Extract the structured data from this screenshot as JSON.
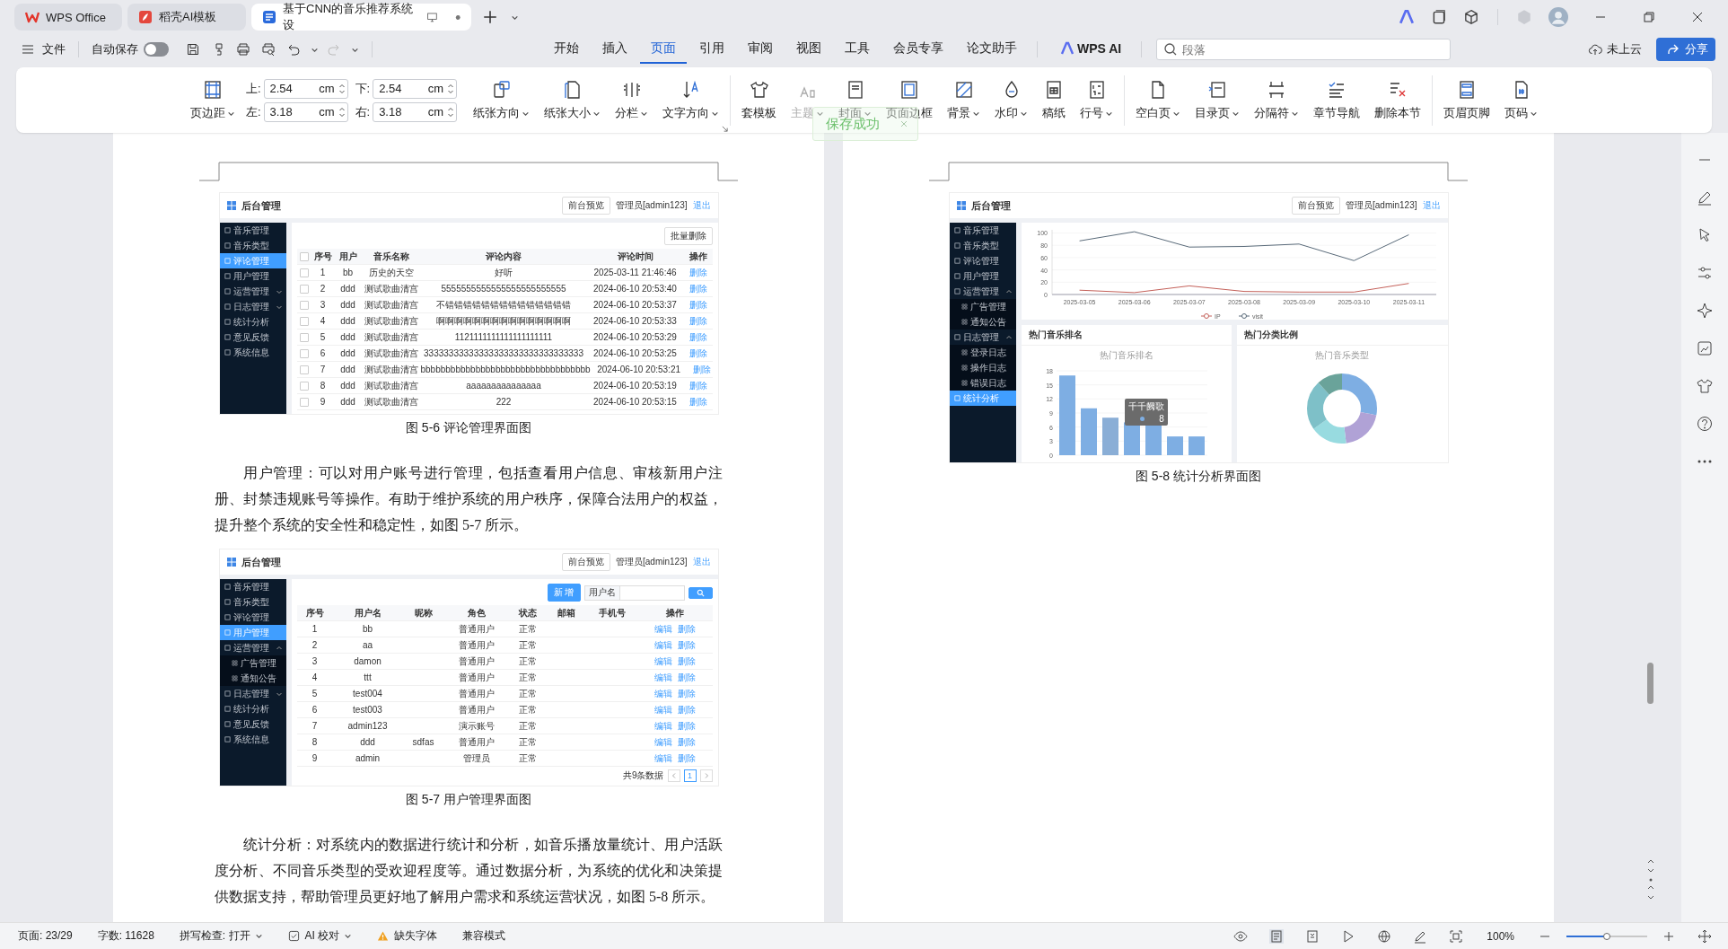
{
  "title_tabs": [
    {
      "label": "WPS Office",
      "kind": "home",
      "selected": false
    },
    {
      "label": "稻壳AI模板",
      "kind": "template",
      "selected": false
    },
    {
      "label": "基于CNN的音乐推荐系统设",
      "kind": "document",
      "selected": true
    }
  ],
  "menu": {
    "file": "文件",
    "autosave": {
      "label": "自动保存",
      "on": false
    },
    "tabs": [
      {
        "label": "开始",
        "selected": false
      },
      {
        "label": "插入",
        "selected": false
      },
      {
        "label": "页面",
        "selected": true
      },
      {
        "label": "引用",
        "selected": false
      },
      {
        "label": "审阅",
        "selected": false
      },
      {
        "label": "视图",
        "selected": false
      },
      {
        "label": "工具",
        "selected": false
      },
      {
        "label": "会员专享",
        "selected": false
      },
      {
        "label": "论文助手",
        "selected": false
      }
    ],
    "ai": "WPS AI",
    "search": {
      "placeholder": "段落"
    },
    "cloud": "未上云",
    "share": "分享"
  },
  "ribbon": {
    "margin_button": "页边距",
    "margins": [
      {
        "label": "上:",
        "value": "2.54",
        "unit": "cm"
      },
      {
        "label": "下:",
        "value": "2.54",
        "unit": "cm"
      },
      {
        "label": "左:",
        "value": "3.18",
        "unit": "cm"
      },
      {
        "label": "右:",
        "value": "3.18",
        "unit": "cm"
      }
    ],
    "groups": [
      [
        {
          "label": "纸张方向",
          "dropdown": true,
          "disabled": false
        },
        {
          "label": "纸张大小",
          "dropdown": true,
          "disabled": false
        },
        {
          "label": "分栏",
          "dropdown": true,
          "disabled": false
        },
        {
          "label": "文字方向",
          "dropdown": true,
          "disabled": false
        }
      ],
      [
        {
          "label": "套模板",
          "dropdown": false,
          "disabled": false
        },
        {
          "label": "主题",
          "dropdown": true,
          "disabled": true
        },
        {
          "label": "封面",
          "dropdown": true,
          "disabled": false
        },
        {
          "label": "页面边框",
          "dropdown": false,
          "disabled": false
        },
        {
          "label": "背景",
          "dropdown": true,
          "disabled": false
        },
        {
          "label": "水印",
          "dropdown": true,
          "disabled": false
        },
        {
          "label": "稿纸",
          "dropdown": false,
          "disabled": false
        },
        {
          "label": "行号",
          "dropdown": true,
          "disabled": false
        }
      ],
      [
        {
          "label": "空白页",
          "dropdown": true,
          "disabled": false
        },
        {
          "label": "目录页",
          "dropdown": true,
          "disabled": false
        },
        {
          "label": "分隔符",
          "dropdown": true,
          "disabled": false
        },
        {
          "label": "章节导航",
          "dropdown": false,
          "disabled": false
        },
        {
          "label": "删除本节",
          "dropdown": false,
          "disabled": false
        }
      ],
      [
        {
          "label": "页眉页脚",
          "dropdown": false,
          "disabled": false
        },
        {
          "label": "页码",
          "dropdown": true,
          "disabled": false
        }
      ]
    ]
  },
  "toast": {
    "text": "保存成功"
  },
  "pages": [
    {
      "blocks": [
        {
          "kind": "figure",
          "figure": {
            "kind": "comments",
            "header_checked": false,
            "header": {
              "title": "后台管理",
              "preview": "前台预览",
              "user": "管理员[admin123]",
              "logout": "退出"
            },
            "sidebar": [
              {
                "label": "音乐管理",
                "selected": false
              },
              {
                "label": "音乐类型",
                "selected": false
              },
              {
                "label": "评论管理",
                "selected": true
              },
              {
                "label": "用户管理",
                "selected": false
              },
              {
                "label": "运营管理",
                "selected": false,
                "expanded": false
              },
              {
                "label": "日志管理",
                "selected": false,
                "expanded": false
              },
              {
                "label": "统计分析",
                "selected": false
              },
              {
                "label": "意见反馈",
                "selected": false
              },
              {
                "label": "系统信息",
                "selected": false
              }
            ],
            "bulk_delete": "批量删除",
            "columns": [
              "序号",
              "用户",
              "音乐名称",
              "评论内容",
              "评论时间",
              "操作"
            ],
            "rows": [
              {
                "checked": false,
                "cells": [
                  "1",
                  "bb",
                  "历史的天空",
                  "好听",
                  "2025-03-11 21:46:46"
                ],
                "action": "删除"
              },
              {
                "checked": false,
                "cells": [
                  "2",
                  "ddd",
                  "测试歌曲清宫",
                  "5555555555555555555555555",
                  "2024-06-10 20:53:40"
                ],
                "action": "删除"
              },
              {
                "checked": false,
                "cells": [
                  "3",
                  "ddd",
                  "测试歌曲清宫",
                  "不错错错错错错错错错错错错错错",
                  "2024-06-10 20:53:37"
                ],
                "action": "删除"
              },
              {
                "checked": false,
                "cells": [
                  "4",
                  "ddd",
                  "测试歌曲清宫",
                  "啊啊啊啊啊啊啊啊啊啊啊啊啊啊啊",
                  "2024-06-10 20:53:33"
                ],
                "action": "删除"
              },
              {
                "checked": false,
                "cells": [
                  "5",
                  "ddd",
                  "测试歌曲清宫",
                  "1121111111111111111111",
                  "2024-06-10 20:53:29"
                ],
                "action": "删除"
              },
              {
                "checked": false,
                "cells": [
                  "6",
                  "ddd",
                  "测试歌曲清宫",
                  "33333333333333333333333333333333",
                  "2024-06-10 20:53:25"
                ],
                "action": "删除"
              },
              {
                "checked": false,
                "cells": [
                  "7",
                  "ddd",
                  "测试歌曲清宫",
                  "bbbbbbbbbbbbbbbbbbbbbbbbbbbbbbbbbb",
                  "2024-06-10 20:53:21"
                ],
                "action": "删除"
              },
              {
                "checked": false,
                "cells": [
                  "8",
                  "ddd",
                  "测试歌曲清宫",
                  "aaaaaaaaaaaaaaa",
                  "2024-06-10 20:53:19"
                ],
                "action": "删除"
              },
              {
                "checked": false,
                "cells": [
                  "9",
                  "ddd",
                  "测试歌曲清宫",
                  "222",
                  "2024-06-10 20:53:15"
                ],
                "action": "删除"
              }
            ]
          }
        },
        {
          "kind": "caption",
          "text": "图 5-6 评论管理界面图"
        },
        {
          "kind": "paragraph",
          "text": "用户管理：可以对用户账号进行管理，包括查看用户信息、审核新用户注册、封禁违规账号等操作。有助于维护系统的用户秩序，保障合法用户的权益，提升整个系统的安全性和稳定性，如图 5-7 所示。"
        },
        {
          "kind": "figure",
          "figure": {
            "kind": "users",
            "header": {
              "title": "后台管理",
              "preview": "前台预览",
              "user": "管理员[admin123]",
              "logout": "退出"
            },
            "sidebar": [
              {
                "label": "音乐管理",
                "selected": false
              },
              {
                "label": "音乐类型",
                "selected": false
              },
              {
                "label": "评论管理",
                "selected": false
              },
              {
                "label": "用户管理",
                "selected": true
              },
              {
                "label": "运营管理",
                "selected": false,
                "expanded": true,
                "children": [
                  {
                    "label": "广告管理"
                  },
                  {
                    "label": "通知公告"
                  }
                ]
              },
              {
                "label": "日志管理",
                "selected": false,
                "expanded": false
              },
              {
                "label": "统计分析",
                "selected": false
              },
              {
                "label": "意见反馈",
                "selected": false
              },
              {
                "label": "系统信息",
                "selected": false
              }
            ],
            "add": "新 增",
            "search_label": "用户名",
            "columns": [
              "序号",
              "用户名",
              "昵称",
              "角色",
              "状态",
              "邮箱",
              "手机号",
              "操作"
            ],
            "rows": [
              {
                "no": "1",
                "username": "bb",
                "role": "普通用户",
                "status": "正常",
                "actions": [
                  "编辑",
                  "删除"
                ]
              },
              {
                "no": "2",
                "username": "aa",
                "role": "普通用户",
                "status": "正常",
                "actions": [
                  "编辑",
                  "删除"
                ]
              },
              {
                "no": "3",
                "username": "damon",
                "role": "普通用户",
                "status": "正常",
                "actions": [
                  "编辑",
                  "删除"
                ]
              },
              {
                "no": "4",
                "username": "ttt",
                "role": "普通用户",
                "status": "正常",
                "actions": [
                  "编辑",
                  "删除"
                ]
              },
              {
                "no": "5",
                "username": "test004",
                "role": "普通用户",
                "status": "正常",
                "actions": [
                  "编辑",
                  "删除"
                ]
              },
              {
                "no": "6",
                "username": "test003",
                "role": "普通用户",
                "status": "正常",
                "actions": [
                  "编辑",
                  "删除"
                ]
              },
              {
                "no": "7",
                "username": "admin123",
                "role": "演示账号",
                "status": "正常",
                "actions": [
                  "编辑",
                  "删除"
                ]
              },
              {
                "no": "8",
                "username": "ddd",
                "nickname": "sdfas",
                "role": "普通用户",
                "status": "正常",
                "actions": [
                  "编辑",
                  "删除"
                ]
              },
              {
                "no": "9",
                "username": "admin",
                "role": "管理员",
                "status": "正常",
                "actions": [
                  "编辑",
                  "删除"
                ]
              }
            ],
            "total": "共9条数据",
            "pages": [
              {
                "label": "1",
                "selected": true
              }
            ]
          }
        },
        {
          "kind": "caption",
          "text": "图 5-7 用户管理界面图"
        },
        {
          "kind": "paragraph",
          "text": "统计分析：对系统内的数据进行统计和分析，如音乐播放量统计、用户活跃度分析、不同音乐类型的受欢迎程度等。通过数据分析，为系统的优化和决策提供数据支持，帮助管理员更好地了解用户需求和系统运营状况，如图 5-8 所示。"
        }
      ]
    },
    {
      "blocks": [
        {
          "kind": "figure",
          "figure": {
            "kind": "stats",
            "header": {
              "title": "后台管理",
              "preview": "前台预览",
              "user": "管理员[admin123]",
              "logout": "退出"
            },
            "sidebar": [
              {
                "label": "音乐管理",
                "selected": false
              },
              {
                "label": "音乐类型",
                "selected": false
              },
              {
                "label": "评论管理",
                "selected": false
              },
              {
                "label": "用户管理",
                "selected": false
              },
              {
                "label": "运营管理",
                "selected": false,
                "expanded": true,
                "children": [
                  {
                    "label": "广告管理"
                  },
                  {
                    "label": "通知公告"
                  }
                ]
              },
              {
                "label": "日志管理",
                "selected": false,
                "expanded": true,
                "children": [
                  {
                    "label": "登录日志"
                  },
                  {
                    "label": "操作日志"
                  },
                  {
                    "label": "错误日志"
                  }
                ]
              },
              {
                "label": "统计分析",
                "selected": true
              }
            ],
            "line_chart": {
              "chart_data": {
                "type": "line",
                "x": [
                  "2025-03-05",
                  "2025-03-06",
                  "2025-03-07",
                  "2025-03-08",
                  "2025-03-09",
                  "2025-03-10",
                  "2025-03-11"
                ],
                "series": [
                  {
                    "name": "IP",
                    "color": "#c4615a",
                    "values": [
                      7,
                      3,
                      14,
                      5,
                      4,
                      4,
                      18
                    ]
                  },
                  {
                    "name": "visit",
                    "color": "#5a6b7a",
                    "values": [
                      87,
                      102,
                      77,
                      78,
                      82,
                      55,
                      97
                    ]
                  }
                ],
                "ylim": [
                  0,
                  105
                ],
                "yticks": [
                  0,
                  20,
                  40,
                  60,
                  80,
                  100
                ],
                "grid": true,
                "legend": "bottom"
              }
            },
            "bar_card": {
              "title": "热门音乐排名",
              "chart_title": "热门音乐排名",
              "axis_labels": [
                "18",
                "15",
                "12",
                "9",
                "6",
                "3",
                "0"
              ],
              "tooltip": {
                "title": "千千阙歌",
                "value": "8"
              }
            },
            "donut_card": {
              "title": "热门分类比例",
              "chart_title": "热门音乐类型"
            }
          }
        },
        {
          "kind": "caption",
          "text": "图 5-8 统计分析界面图"
        }
      ]
    }
  ],
  "status_bar": {
    "items": [
      {
        "text": "页面: 23/29",
        "kind": "plain"
      },
      {
        "text": "字数: 11628",
        "kind": "plain"
      },
      {
        "text": "拼写检查: 打开",
        "kind": "dropdown"
      },
      {
        "text": "AI 校对",
        "kind": "ai"
      },
      {
        "text": "缺失字体",
        "kind": "warning"
      },
      {
        "text": "兼容模式",
        "kind": "plain"
      }
    ],
    "zoom": {
      "text": "100%",
      "level": 0.5
    }
  }
}
